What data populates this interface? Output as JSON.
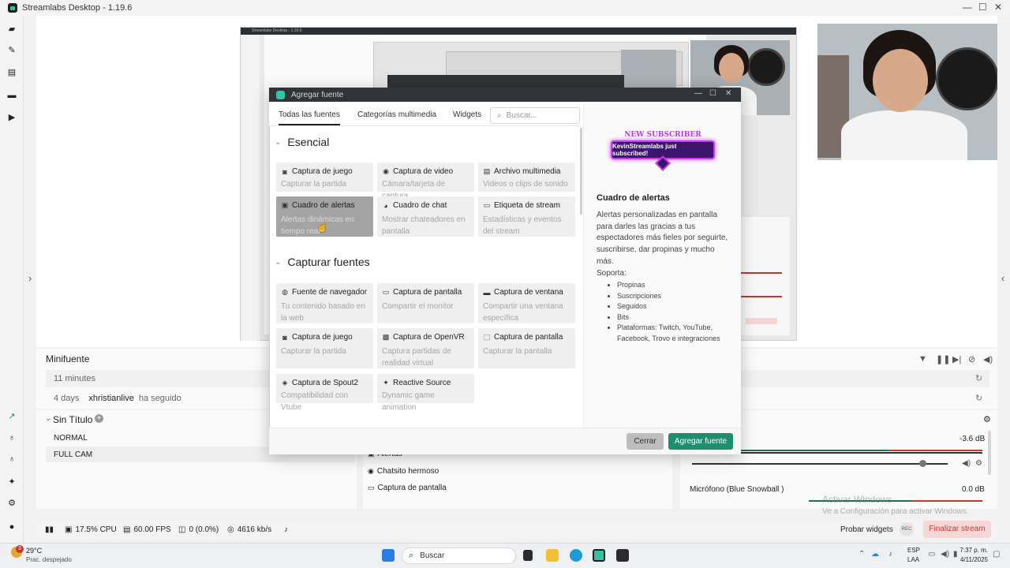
{
  "app": {
    "title": "Streamlabs Desktop - 1.19.6"
  },
  "preview": {
    "inner_title": "Streamlabs Desktop - 1.19.6"
  },
  "modal": {
    "title": "Agregar fuente",
    "tabs": [
      "Todas las fuentes",
      "Categorías multimedia",
      "Widgets"
    ],
    "search_placeholder": "Buscar...",
    "sections": {
      "esencial": "Esencial",
      "capturar": "Capturar fuentes"
    },
    "essential_cards": [
      {
        "title": "Captura de juego",
        "desc": "Capturar la partida",
        "icon": "gamepad-icon"
      },
      {
        "title": "Captura de video",
        "desc": "Cámara/tarjeta de captura",
        "icon": "webcam-icon"
      },
      {
        "title": "Archivo multimedia",
        "desc": "Videos o clips de sonido",
        "icon": "file-icon"
      },
      {
        "title": "Cuadro de alertas",
        "desc": "Alertas dinámicas en tiempo real",
        "icon": "alert-box-icon"
      },
      {
        "title": "Cuadro de chat",
        "desc": "Mostrar chateadores en pantalla",
        "icon": "chat-icon"
      },
      {
        "title": "Etiqueta de stream",
        "desc": "Estadísticas y eventos del stream",
        "icon": "tag-icon"
      }
    ],
    "capture_cards": [
      {
        "title": "Fuente de navegador",
        "desc": "Tu contenido basado en la web",
        "icon": "globe-icon"
      },
      {
        "title": "Captura de pantalla",
        "desc": "Compartir el monitor",
        "icon": "monitor-icon"
      },
      {
        "title": "Captura de ventana",
        "desc": "Compartir una ventana específica",
        "icon": "window-icon"
      },
      {
        "title": "Captura de juego",
        "desc": "Capturar la partida",
        "icon": "gamepad-icon"
      },
      {
        "title": "Captura de OpenVR",
        "desc": "Captura partidas de realidad virtual",
        "icon": "vr-icon"
      },
      {
        "title": "Captura de pantalla",
        "desc": "Capturar la pantalla",
        "icon": "dotted-monitor-icon"
      },
      {
        "title": "Captura de Spout2",
        "desc": "Compatibilidad con Vtube",
        "icon": "shield-icon"
      },
      {
        "title": "Reactive Source",
        "desc": "Dynamic game animation",
        "icon": "sparkle-icon"
      }
    ],
    "detail": {
      "banner_new": "NEW SUBSCRIBER",
      "banner_text": "KevinStreamlabs just subscribed!",
      "title": "Cuadro de alertas",
      "description": "Alertas personalizadas en pantalla para darles las gracias a tus espectadores más fieles por seguirte, suscribirse, dar propinas y mucho más.",
      "supports_label": "Soporta:",
      "supports": [
        "Propinas",
        "Suscripciones",
        "Seguidos",
        "Bits",
        "Plataformas: Twitch, YouTube, Facebook, Trovo e integraciones"
      ]
    },
    "cancel_label": "Cerrar",
    "add_label": "Agregar fuente"
  },
  "minifeed": {
    "title": "Minifuente",
    "rows": [
      {
        "time": "11 minutes",
        "user": "",
        "action": ""
      },
      {
        "time": "4 days",
        "user": "xhristianlive",
        "action": "ha seguido"
      }
    ]
  },
  "scenes": {
    "title": "Sin Título",
    "items": [
      "NORMAL",
      "FULL CAM"
    ]
  },
  "sources": {
    "items": [
      "Alertas",
      "Chatsito hermoso",
      "Captura de pantalla"
    ]
  },
  "mixer": {
    "top_db": "-3.6 dB",
    "mic_label": "Micrófono (Blue Snowball )",
    "mic_db": "0.0 dB"
  },
  "watermark": {
    "line1": "Activar Windows",
    "line2": "Ve a Configuración para activar Windows."
  },
  "footer": {
    "cpu": "17.5% CPU",
    "fps": "60.00 FPS",
    "dropped": "0 (0.0%)",
    "bitrate": "4616 kb/s",
    "test_widgets": "Probar widgets",
    "rec": "REC",
    "end_stream": "Finalizar stream"
  },
  "taskbar": {
    "weather_temp": "29°C",
    "weather_desc": "Prac. despejado",
    "weather_badge": "3",
    "search": "Buscar",
    "lang1": "ESP",
    "lang2": "LAA",
    "time": "7:37 p. m.",
    "date": "4/11/2025"
  },
  "colors": {
    "accent": "#1d8f6f",
    "modal_header": "#303338",
    "end_stream_bg": "#f6d7d8",
    "end_stream_text": "#c0392b"
  }
}
